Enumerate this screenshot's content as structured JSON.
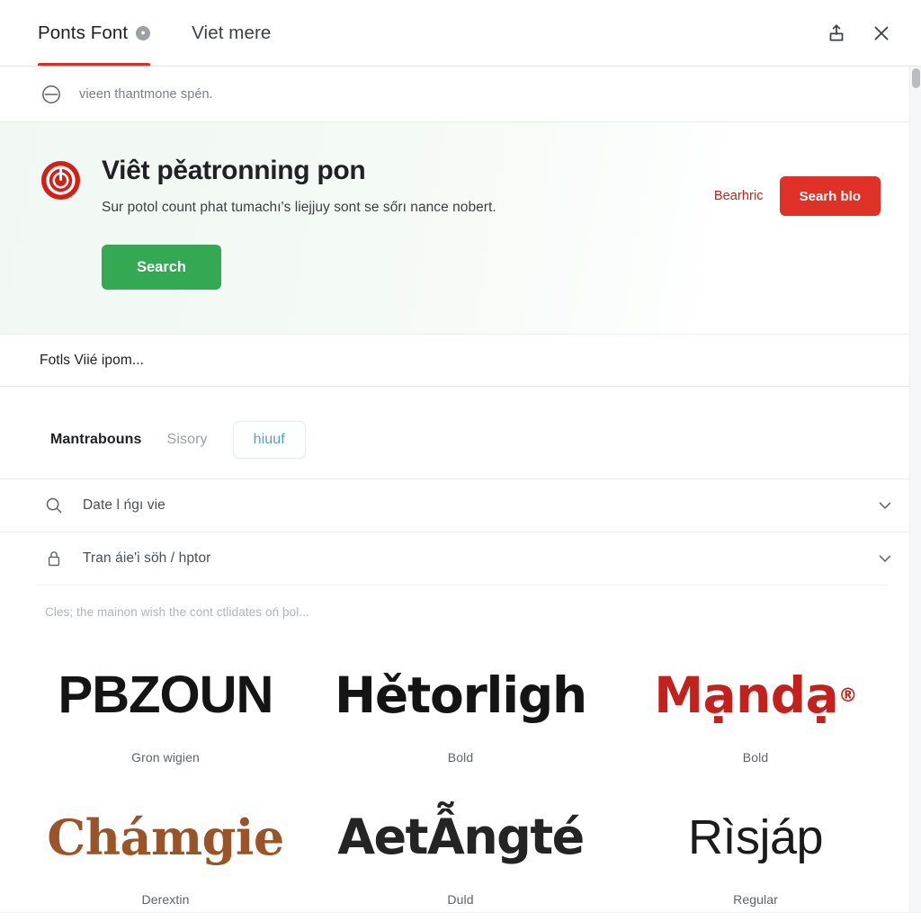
{
  "window": {
    "tabs": [
      {
        "label": "Ponts Font",
        "badge": "●",
        "active": true
      },
      {
        "label": "Viet mere",
        "active": false
      }
    ],
    "actions": {
      "share_label": "share-icon",
      "close_label": "close-icon"
    }
  },
  "filterbar": {
    "icon": "minus-circle-icon",
    "text": "vieen thantmone spén."
  },
  "hero": {
    "logo": "power-shield-icon",
    "title": "Viêt pěatronning pon",
    "subtitle": "Sur potol count phat tumachı's liejjuy sont se sőrı nance nobert.",
    "cta_label": "Search",
    "link_label": "Bearhric",
    "pill_label": "Searh blo",
    "accent_green": "#34a853",
    "accent_red": "#e03127",
    "link_red": "#c5221f"
  },
  "caption_strip": {
    "text": "Fotls Viié ipom..."
  },
  "subtabs": [
    {
      "label": "Mantrabouns",
      "style": "bold"
    },
    {
      "label": "Sisory",
      "style": "muted"
    },
    {
      "label": "hiuuf",
      "style": "chip"
    }
  ],
  "accordion": {
    "rows": [
      {
        "icon": "search-icon",
        "label": "Date l ńgı vie",
        "chevron": "chevron-down-icon"
      },
      {
        "icon": "lock-icon",
        "label": "Tran áie'i söh / hptor",
        "chevron": "chevron-down-icon"
      }
    ]
  },
  "hint": {
    "text": "Cles; the mainon wish the cont ctlidates oń þol..."
  },
  "specimens": [
    {
      "sample": "PBZOUN",
      "caption": "Gron wigien",
      "color": "#141414",
      "style": "sp-1"
    },
    {
      "sample": "Hětorligh",
      "caption": "Bold",
      "color": "#141414",
      "style": "sp-2"
    },
    {
      "sample": "Mạndạ",
      "caption": "Bold",
      "color": "#c5211c",
      "style": "sp-3",
      "superscript": "®"
    },
    {
      "sample": "Chámgie",
      "caption": "Derextin",
      "color": "#9a5427",
      "style": "sp-4"
    },
    {
      "sample": "AetẪngté",
      "caption": "Duld",
      "color": "#242424",
      "style": "sp-5"
    },
    {
      "sample": "Rìsjáp",
      "caption": "Regular",
      "color": "#1b1b1b",
      "style": "sp-6"
    }
  ]
}
